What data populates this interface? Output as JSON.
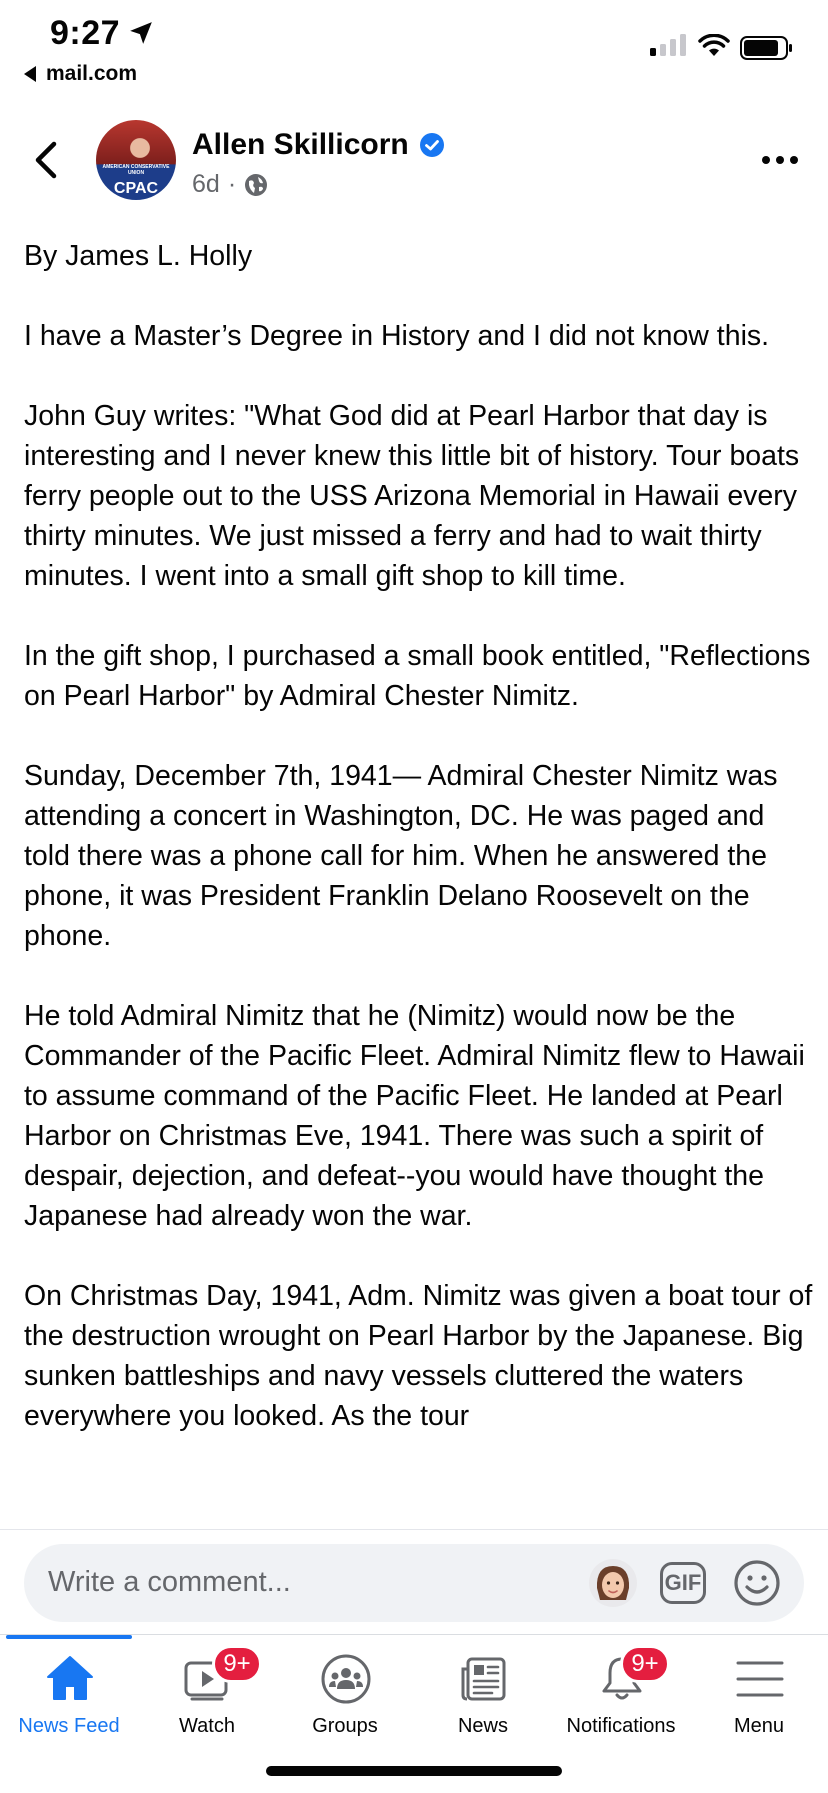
{
  "status_bar": {
    "time": "9:27",
    "back_app": "mail.com",
    "icons": [
      "location-arrow-icon",
      "cellular-signal-icon",
      "wifi-icon",
      "battery-icon"
    ]
  },
  "post": {
    "author": "Allen Skillicorn",
    "verified": true,
    "avatar_text": {
      "top": "AMERICAN CONSERVATIVE UNION",
      "main": "CPAC"
    },
    "timestamp": "6d",
    "separator": "·",
    "privacy_icon": "globe-icon",
    "paragraphs": [
      "By James L. Holly",
      "I have a Master’s Degree in History and I did not know this.",
      "John Guy writes: \"What God did at Pearl Harbor that day is interesting and I never knew this little bit of history. Tour boats ferry people out to the USS Arizona Memorial in Hawaii every thirty minutes. We just missed a ferry and had to wait thirty minutes. I went into a small gift shop to kill time.",
      "In the gift shop, I purchased a small book entitled, \"Reflections on Pearl Harbor\" by Admiral Chester Nimitz.",
      "Sunday, December 7th, 1941— Admiral Chester Nimitz was attending a concert in Washington, DC. He was paged and told there was a phone call for him. When he answered the phone, it was President Franklin Delano Roosevelt on the phone.",
      "He told Admiral Nimitz that he (Nimitz) would now be the Commander of the Pacific Fleet. Admiral Nimitz flew to Hawaii to assume command of the Pacific Fleet. He landed at Pearl Harbor on Christmas Eve, 1941. There was such a spirit of despair, dejection, and defeat--you would have thought the Japanese had already won the war.",
      "On Christmas Day, 1941, Adm. Nimitz was given a boat tour of the destruction wrought on Pearl Harbor by the Japanese. Big sunken battleships and navy vessels cluttered the waters everywhere you looked. As the tour"
    ]
  },
  "comment": {
    "placeholder": "Write a comment...",
    "gif_label": "GIF"
  },
  "tabs": [
    {
      "label": "News Feed",
      "icon": "home-icon",
      "active": true,
      "badge": ""
    },
    {
      "label": "Watch",
      "icon": "watch-video-icon",
      "active": false,
      "badge": "9+"
    },
    {
      "label": "Groups",
      "icon": "groups-icon",
      "active": false,
      "badge": ""
    },
    {
      "label": "News",
      "icon": "news-icon",
      "active": false,
      "badge": ""
    },
    {
      "label": "Notifications",
      "icon": "bell-icon",
      "active": false,
      "badge": "9+"
    },
    {
      "label": "Menu",
      "icon": "menu-icon",
      "active": false,
      "badge": ""
    }
  ],
  "colors": {
    "accent": "#1877f2",
    "badge": "#e41e3f",
    "secondary_text": "#65676b"
  }
}
